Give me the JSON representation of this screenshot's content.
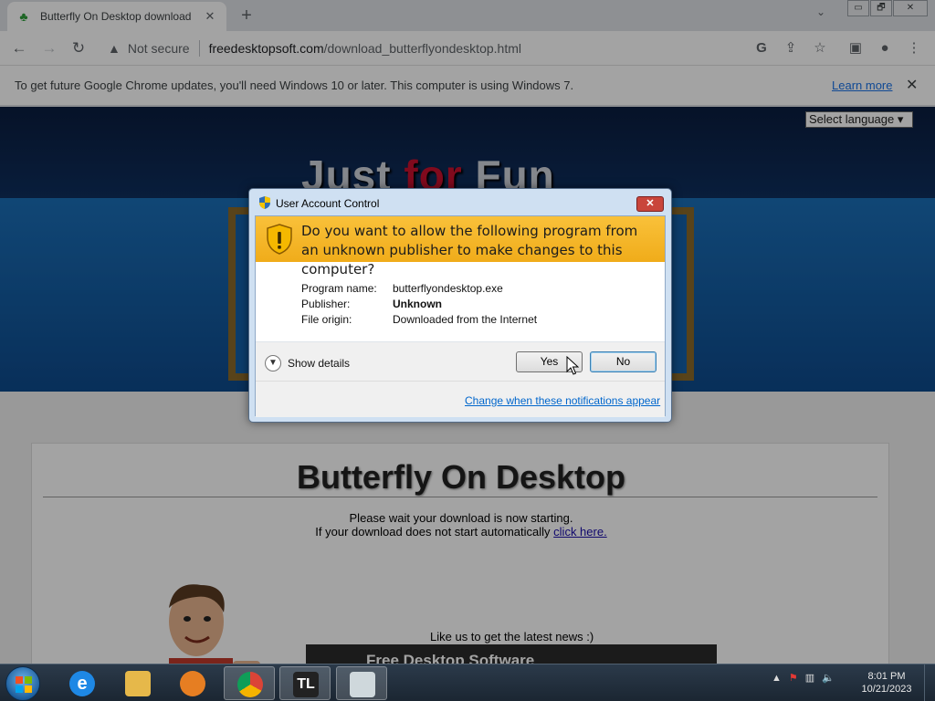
{
  "browser": {
    "tab_title": "Butterfly On Desktop download",
    "tab_close": "✕",
    "new_tab": "+",
    "tab_search": "⌄",
    "window_controls": [
      "▭",
      "🗗",
      "✕"
    ],
    "security_label": "Not secure",
    "url_host": "freedesktopsoft.com",
    "url_path": "/download_butterflyondesktop.html",
    "icons": [
      "back-icon",
      "forward-icon",
      "reload-icon",
      "warning-icon",
      "google-icon",
      "share-icon",
      "star-icon",
      "sidepanel-icon",
      "profile-icon",
      "menu-icon"
    ]
  },
  "infobar": {
    "message": "To get future Google Chrome updates, you'll need Windows 10 or later. This computer is using Windows 7.",
    "learn_more": "Learn more",
    "close": "✕"
  },
  "page": {
    "logo_part1": "Just ",
    "logo_part2": "for",
    "logo_part3": " Fun",
    "language_select": "Select language ▾",
    "heading": "Butterfly On Desktop",
    "wait_text": "Please wait your download is now starting.",
    "manual_text": "If your download does not start automatically ",
    "click_here": "click here.",
    "like_text": "Like us to get the latest news :)",
    "fb_title": "Free Desktop Software"
  },
  "uac": {
    "title": "User Account Control",
    "close": "✕",
    "question": "Do you want to allow the following program from an unknown publisher to make changes to this computer?",
    "fields": [
      {
        "label": "Program name:",
        "value": "butterflyondesktop.exe"
      },
      {
        "label": "Publisher:",
        "value": "Unknown"
      },
      {
        "label": "File origin:",
        "value": "Downloaded from the Internet"
      }
    ],
    "show_details": "Show details",
    "yes": "Yes",
    "no": "No",
    "change_link": "Change when these notifications appear"
  },
  "taskbar": {
    "time": "8:01 PM",
    "date": "10/21/2023",
    "tray_arrow": "▲",
    "colors": {
      "ie": "#1e88e5",
      "chrome": "#4caf50",
      "tl": "#222222"
    },
    "apps": [
      "internet-explorer-icon",
      "file-explorer-icon",
      "media-player-icon",
      "chrome-icon",
      "tl-app-icon",
      "installer-icon"
    ],
    "tl_label": "TL"
  }
}
